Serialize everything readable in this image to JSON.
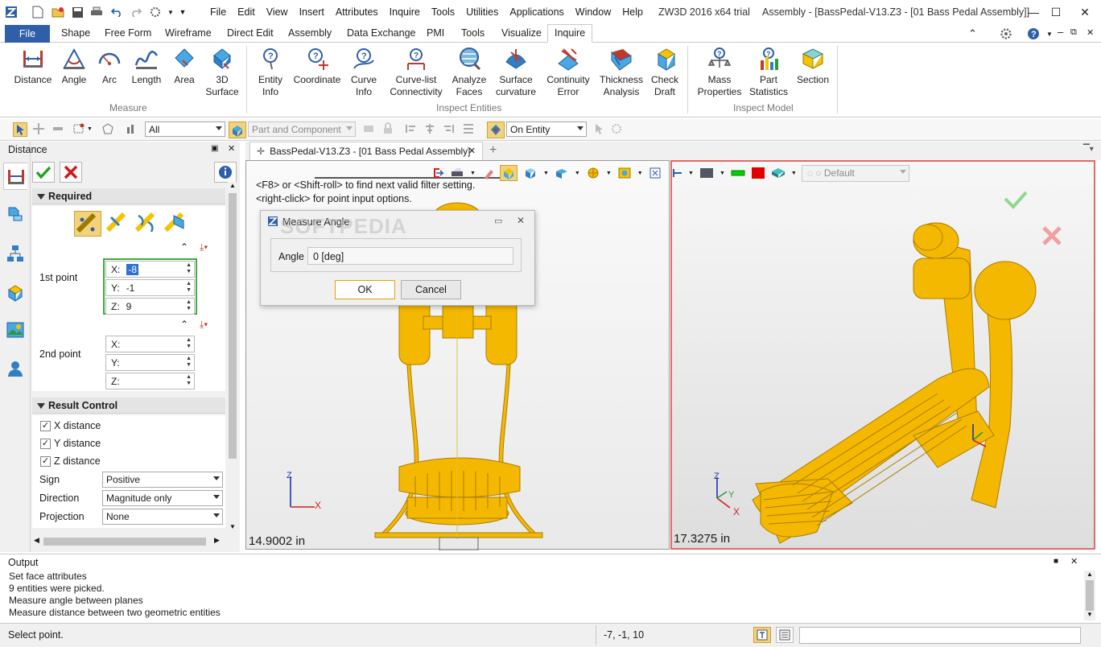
{
  "menu": [
    "File",
    "Edit",
    "View",
    "Insert",
    "Attributes",
    "Inquire",
    "Tools",
    "Utilities",
    "Applications",
    "Window",
    "Help"
  ],
  "title": {
    "app": "ZW3D 2016  x64 trial",
    "project": "Assembly - [BassPedal-V13.Z3 - [01 Bass Pedal Assembly]]"
  },
  "ribbon_tabs": [
    "File",
    "Shape",
    "Free Form",
    "Wireframe",
    "Direct Edit",
    "Assembly",
    "Data Exchange",
    "PMI",
    "Tools",
    "Visualize",
    "Inquire"
  ],
  "ribbon": {
    "measure": {
      "label": "Measure",
      "items": [
        "Distance",
        "Angle",
        "Arc",
        "Length",
        "Area",
        "3D Surface"
      ]
    },
    "inspect_entities": {
      "label": "Inspect Entities",
      "items": [
        "Entity Info",
        "Coordinate",
        "Curve Info",
        "Curve-list Connectivity",
        "Analyze Faces",
        "Surface curvature",
        "Continuity Error",
        "Thickness Analysis",
        "Check Draft"
      ]
    },
    "inspect_model": {
      "label": "Inspect Model",
      "items": [
        "Mass Properties",
        "Part Statistics",
        "Section"
      ]
    }
  },
  "toolbar": {
    "filter": "All",
    "pick_mode": "Part and Component",
    "pick_target": "On Entity"
  },
  "panel": {
    "title": "Distance",
    "required": "Required",
    "first_point": {
      "label": "1st point",
      "x": "-8",
      "y": "-1",
      "z": "9"
    },
    "second_point": {
      "label": "2nd point",
      "x": "",
      "y": "",
      "z": ""
    },
    "axes": {
      "x": "X:",
      "y": "Y:",
      "z": "Z:"
    },
    "result_control": "Result Control",
    "checks": [
      "X distance",
      "Y distance",
      "Z distance"
    ],
    "sign": {
      "label": "Sign",
      "value": "Positive"
    },
    "direction": {
      "label": "Direction",
      "value": "Magnitude only"
    },
    "projection": {
      "label": "Projection",
      "value": "None"
    }
  },
  "doc_tab": "BassPedal-V13.Z3 - [01 Bass Pedal Assembly]",
  "viewport_left": {
    "hint1": "<F8> or <Shift-roll> to find next valid filter setting.",
    "hint2": "<right-click> for point input options.",
    "scale": "14.9002 in"
  },
  "viewport_right": {
    "render": "Default",
    "scale": "17.3275 in"
  },
  "dialog": {
    "title": "Measure Angle",
    "label": "Angle",
    "value": "0  [deg]",
    "ok": "OK",
    "cancel": "Cancel"
  },
  "watermark": "SOFTPEDIA",
  "output": {
    "title": "Output",
    "lines": [
      "Set face attributes",
      "9 entities were picked.",
      "Measure angle between planes",
      "Measure distance between two geometric entities"
    ]
  },
  "status": {
    "prompt": "Select point.",
    "coords": "-7, -1, 10"
  },
  "colors": {
    "accent": "#2e5fa8",
    "model": "#f5b800",
    "highlight": "#e06a6a",
    "green": "#00a000"
  }
}
